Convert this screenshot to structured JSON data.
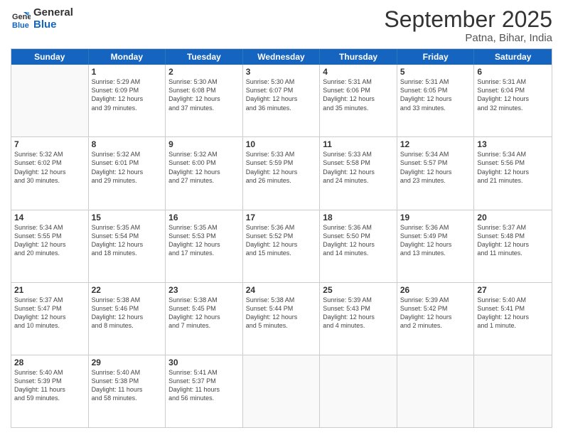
{
  "header": {
    "logo_line1": "General",
    "logo_line2": "Blue",
    "title": "September 2025",
    "subtitle": "Patna, Bihar, India"
  },
  "columns": [
    "Sunday",
    "Monday",
    "Tuesday",
    "Wednesday",
    "Thursday",
    "Friday",
    "Saturday"
  ],
  "weeks": [
    [
      {
        "day": "",
        "info": ""
      },
      {
        "day": "1",
        "info": "Sunrise: 5:29 AM\nSunset: 6:09 PM\nDaylight: 12 hours\nand 39 minutes."
      },
      {
        "day": "2",
        "info": "Sunrise: 5:30 AM\nSunset: 6:08 PM\nDaylight: 12 hours\nand 37 minutes."
      },
      {
        "day": "3",
        "info": "Sunrise: 5:30 AM\nSunset: 6:07 PM\nDaylight: 12 hours\nand 36 minutes."
      },
      {
        "day": "4",
        "info": "Sunrise: 5:31 AM\nSunset: 6:06 PM\nDaylight: 12 hours\nand 35 minutes."
      },
      {
        "day": "5",
        "info": "Sunrise: 5:31 AM\nSunset: 6:05 PM\nDaylight: 12 hours\nand 33 minutes."
      },
      {
        "day": "6",
        "info": "Sunrise: 5:31 AM\nSunset: 6:04 PM\nDaylight: 12 hours\nand 32 minutes."
      }
    ],
    [
      {
        "day": "7",
        "info": "Sunrise: 5:32 AM\nSunset: 6:02 PM\nDaylight: 12 hours\nand 30 minutes."
      },
      {
        "day": "8",
        "info": "Sunrise: 5:32 AM\nSunset: 6:01 PM\nDaylight: 12 hours\nand 29 minutes."
      },
      {
        "day": "9",
        "info": "Sunrise: 5:32 AM\nSunset: 6:00 PM\nDaylight: 12 hours\nand 27 minutes."
      },
      {
        "day": "10",
        "info": "Sunrise: 5:33 AM\nSunset: 5:59 PM\nDaylight: 12 hours\nand 26 minutes."
      },
      {
        "day": "11",
        "info": "Sunrise: 5:33 AM\nSunset: 5:58 PM\nDaylight: 12 hours\nand 24 minutes."
      },
      {
        "day": "12",
        "info": "Sunrise: 5:34 AM\nSunset: 5:57 PM\nDaylight: 12 hours\nand 23 minutes."
      },
      {
        "day": "13",
        "info": "Sunrise: 5:34 AM\nSunset: 5:56 PM\nDaylight: 12 hours\nand 21 minutes."
      }
    ],
    [
      {
        "day": "14",
        "info": "Sunrise: 5:34 AM\nSunset: 5:55 PM\nDaylight: 12 hours\nand 20 minutes."
      },
      {
        "day": "15",
        "info": "Sunrise: 5:35 AM\nSunset: 5:54 PM\nDaylight: 12 hours\nand 18 minutes."
      },
      {
        "day": "16",
        "info": "Sunrise: 5:35 AM\nSunset: 5:53 PM\nDaylight: 12 hours\nand 17 minutes."
      },
      {
        "day": "17",
        "info": "Sunrise: 5:36 AM\nSunset: 5:52 PM\nDaylight: 12 hours\nand 15 minutes."
      },
      {
        "day": "18",
        "info": "Sunrise: 5:36 AM\nSunset: 5:50 PM\nDaylight: 12 hours\nand 14 minutes."
      },
      {
        "day": "19",
        "info": "Sunrise: 5:36 AM\nSunset: 5:49 PM\nDaylight: 12 hours\nand 13 minutes."
      },
      {
        "day": "20",
        "info": "Sunrise: 5:37 AM\nSunset: 5:48 PM\nDaylight: 12 hours\nand 11 minutes."
      }
    ],
    [
      {
        "day": "21",
        "info": "Sunrise: 5:37 AM\nSunset: 5:47 PM\nDaylight: 12 hours\nand 10 minutes."
      },
      {
        "day": "22",
        "info": "Sunrise: 5:38 AM\nSunset: 5:46 PM\nDaylight: 12 hours\nand 8 minutes."
      },
      {
        "day": "23",
        "info": "Sunrise: 5:38 AM\nSunset: 5:45 PM\nDaylight: 12 hours\nand 7 minutes."
      },
      {
        "day": "24",
        "info": "Sunrise: 5:38 AM\nSunset: 5:44 PM\nDaylight: 12 hours\nand 5 minutes."
      },
      {
        "day": "25",
        "info": "Sunrise: 5:39 AM\nSunset: 5:43 PM\nDaylight: 12 hours\nand 4 minutes."
      },
      {
        "day": "26",
        "info": "Sunrise: 5:39 AM\nSunset: 5:42 PM\nDaylight: 12 hours\nand 2 minutes."
      },
      {
        "day": "27",
        "info": "Sunrise: 5:40 AM\nSunset: 5:41 PM\nDaylight: 12 hours\nand 1 minute."
      }
    ],
    [
      {
        "day": "28",
        "info": "Sunrise: 5:40 AM\nSunset: 5:39 PM\nDaylight: 11 hours\nand 59 minutes."
      },
      {
        "day": "29",
        "info": "Sunrise: 5:40 AM\nSunset: 5:38 PM\nDaylight: 11 hours\nand 58 minutes."
      },
      {
        "day": "30",
        "info": "Sunrise: 5:41 AM\nSunset: 5:37 PM\nDaylight: 11 hours\nand 56 minutes."
      },
      {
        "day": "",
        "info": ""
      },
      {
        "day": "",
        "info": ""
      },
      {
        "day": "",
        "info": ""
      },
      {
        "day": "",
        "info": ""
      }
    ]
  ]
}
